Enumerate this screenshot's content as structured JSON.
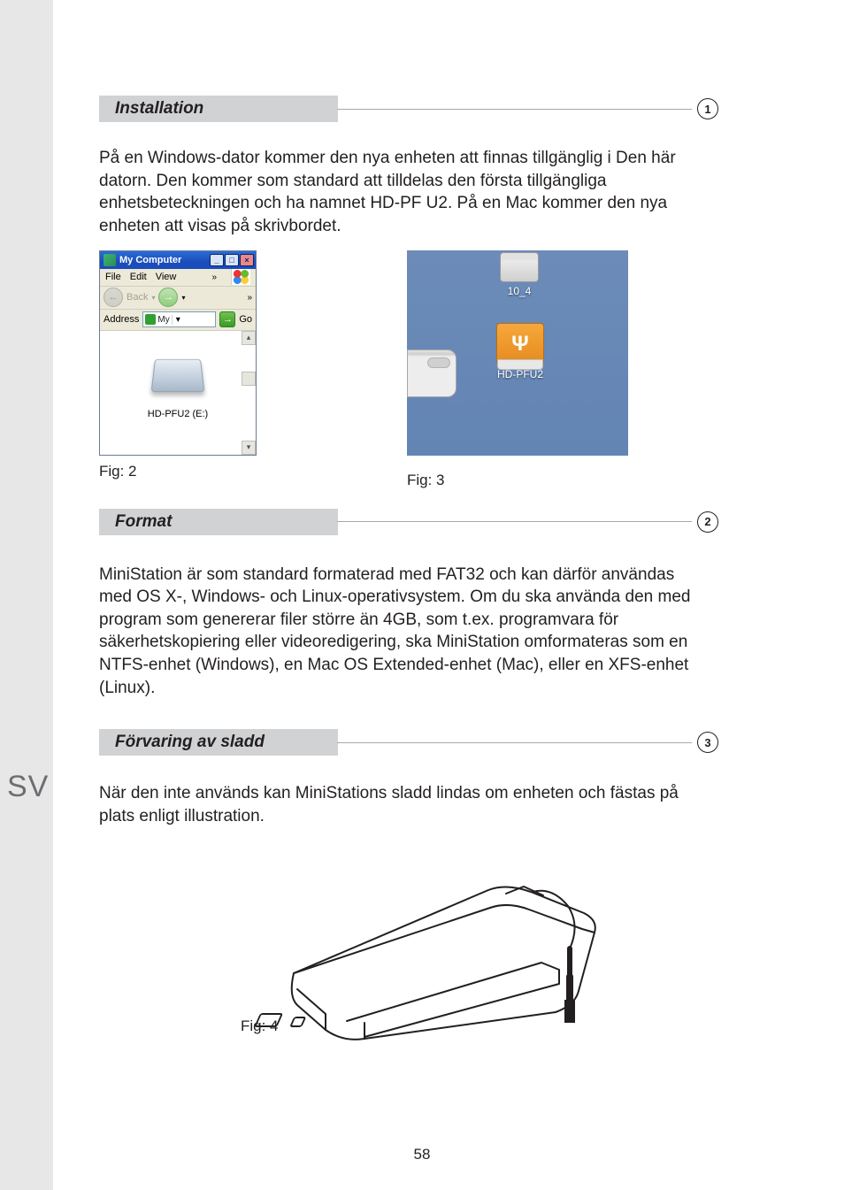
{
  "sideTab": "SV",
  "pageNumber": "58",
  "sections": {
    "s1": {
      "title": "Installation",
      "num": "1",
      "para": "På en Windows-dator kommer den nya enheten att finnas tillgänglig i Den här datorn. Den kommer som standard att tilldelas den första tillgängliga enhetsbeteckningen och ha namnet HD-PF U2. På en Mac kommer den nya enheten att visas på skrivbordet."
    },
    "s2": {
      "title": "Format",
      "num": "2",
      "para": "MiniStation är som standard formaterad med FAT32 och kan därför användas med OS X-, Windows- och Linux-operativsystem. Om du ska använda den med program som genererar filer större än 4GB, som t.ex. programvara för säkerhetskopiering eller videoredigering, ska MiniStation omformateras som en NTFS-enhet (Windows), en Mac OS Extended-enhet (Mac), eller en XFS-enhet (Linux)."
    },
    "s3": {
      "title": "Förvaring av sladd",
      "num": "3",
      "para": "När den inte används kan MiniStations sladd lindas om enheten och fästas på plats enligt illustration."
    }
  },
  "fig2": {
    "caption": "Fig: 2",
    "title": "My Computer",
    "menu": {
      "file": "File",
      "edit": "Edit",
      "view": "View"
    },
    "toolbar": {
      "back": "Back"
    },
    "address": {
      "label": "Address",
      "value": "My",
      "go": "Go"
    },
    "driveLabel": "HD-PFU2 (E:)"
  },
  "fig3": {
    "caption": "Fig: 3",
    "hdLabel": "10_4",
    "usbLabel": "HD-PFU2"
  },
  "fig4": {
    "caption": "Fig: 4"
  }
}
